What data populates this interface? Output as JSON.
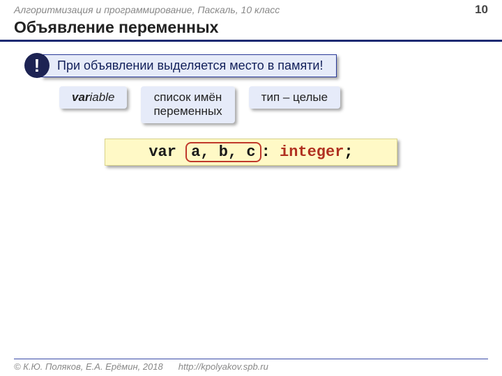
{
  "header": {
    "breadcrumb": "Алгоритмизация и программирование, Паскаль, 10 класс",
    "pagenum": "10"
  },
  "title": "Объявление переменных",
  "callout": {
    "bang": "!",
    "text": "При объявлении выделяется место в памяти!"
  },
  "labels": {
    "l1_bold": "var",
    "l1_rest": "iable",
    "l2_line1": "список имён",
    "l2_line2": "переменных",
    "l3": "тип – целые"
  },
  "code": {
    "kw": "var",
    "ids": "a, b, c",
    "colon": ":",
    "type": "integer",
    "semi": ";"
  },
  "footer": {
    "copyright": "© К.Ю. Поляков, Е.А. Ерёмин, 2018",
    "url": "http://kpolyakov.spb.ru"
  }
}
